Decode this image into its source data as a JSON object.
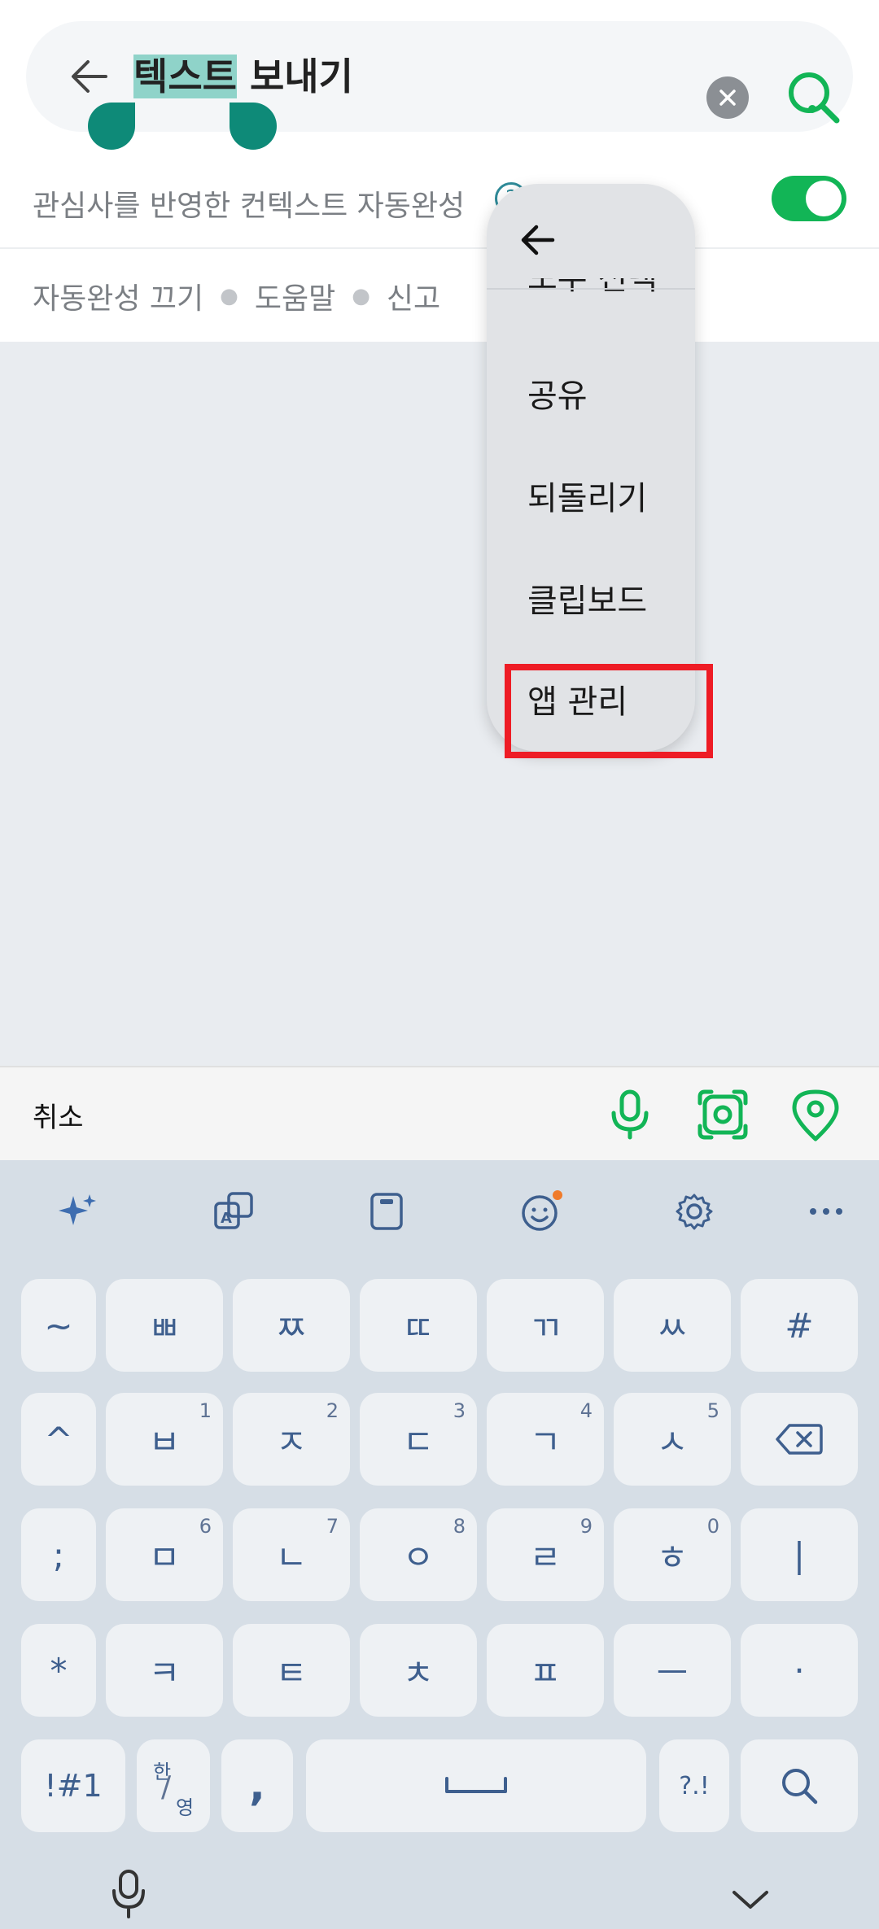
{
  "search": {
    "query_selected": "텍스트",
    "query_rest": " 보내기"
  },
  "autocomplete": {
    "label": "관심사를 반영한 컨텍스트 자동완성",
    "toggle_on": true
  },
  "links": [
    "자동완성 끄기",
    "도움말",
    "신고"
  ],
  "context_menu": {
    "items": [
      "모두 선택",
      "공유",
      "되돌리기",
      "클립보드",
      "앱 관리"
    ],
    "highlighted": "앱 관리"
  },
  "keyboard_toolbar": {
    "cancel_label": "취소"
  },
  "keyboard": {
    "rows": [
      [
        {
          "label": "~"
        },
        {
          "label": "ㅃ"
        },
        {
          "label": "ㅉ"
        },
        {
          "label": "ㄸ"
        },
        {
          "label": "ㄲ"
        },
        {
          "label": "ㅆ"
        },
        {
          "label": "#"
        }
      ],
      [
        {
          "label": "^"
        },
        {
          "label": "ㅂ",
          "sub": "1"
        },
        {
          "label": "ㅈ",
          "sub": "2"
        },
        {
          "label": "ㄷ",
          "sub": "3"
        },
        {
          "label": "ㄱ",
          "sub": "4"
        },
        {
          "label": "ㅅ",
          "sub": "5"
        },
        {
          "label": "⌫"
        }
      ],
      [
        {
          "label": ";"
        },
        {
          "label": "ㅁ",
          "sub": "6"
        },
        {
          "label": "ㄴ",
          "sub": "7"
        },
        {
          "label": "ㅇ",
          "sub": "8"
        },
        {
          "label": "ㄹ",
          "sub": "9"
        },
        {
          "label": "ㅎ",
          "sub": "0"
        },
        {
          "label": "|"
        }
      ],
      [
        {
          "label": "*"
        },
        {
          "label": "ㅋ"
        },
        {
          "label": "ㅌ"
        },
        {
          "label": "ㅊ"
        },
        {
          "label": "ㅍ"
        },
        {
          "label": "ㅡ"
        },
        {
          "label": "·"
        }
      ]
    ],
    "bottom_row": {
      "symbols": "!#1",
      "lang_top": "한",
      "lang_bottom": "영",
      "comma": ",",
      "punct": "?.!",
      "space_symbol": "␣"
    }
  },
  "colors": {
    "accent_green": "#12b556",
    "selection": "#8fd3c9",
    "handle": "#0e8a78",
    "highlight_box": "#ee1c25",
    "key_text": "#3e5f8e"
  }
}
